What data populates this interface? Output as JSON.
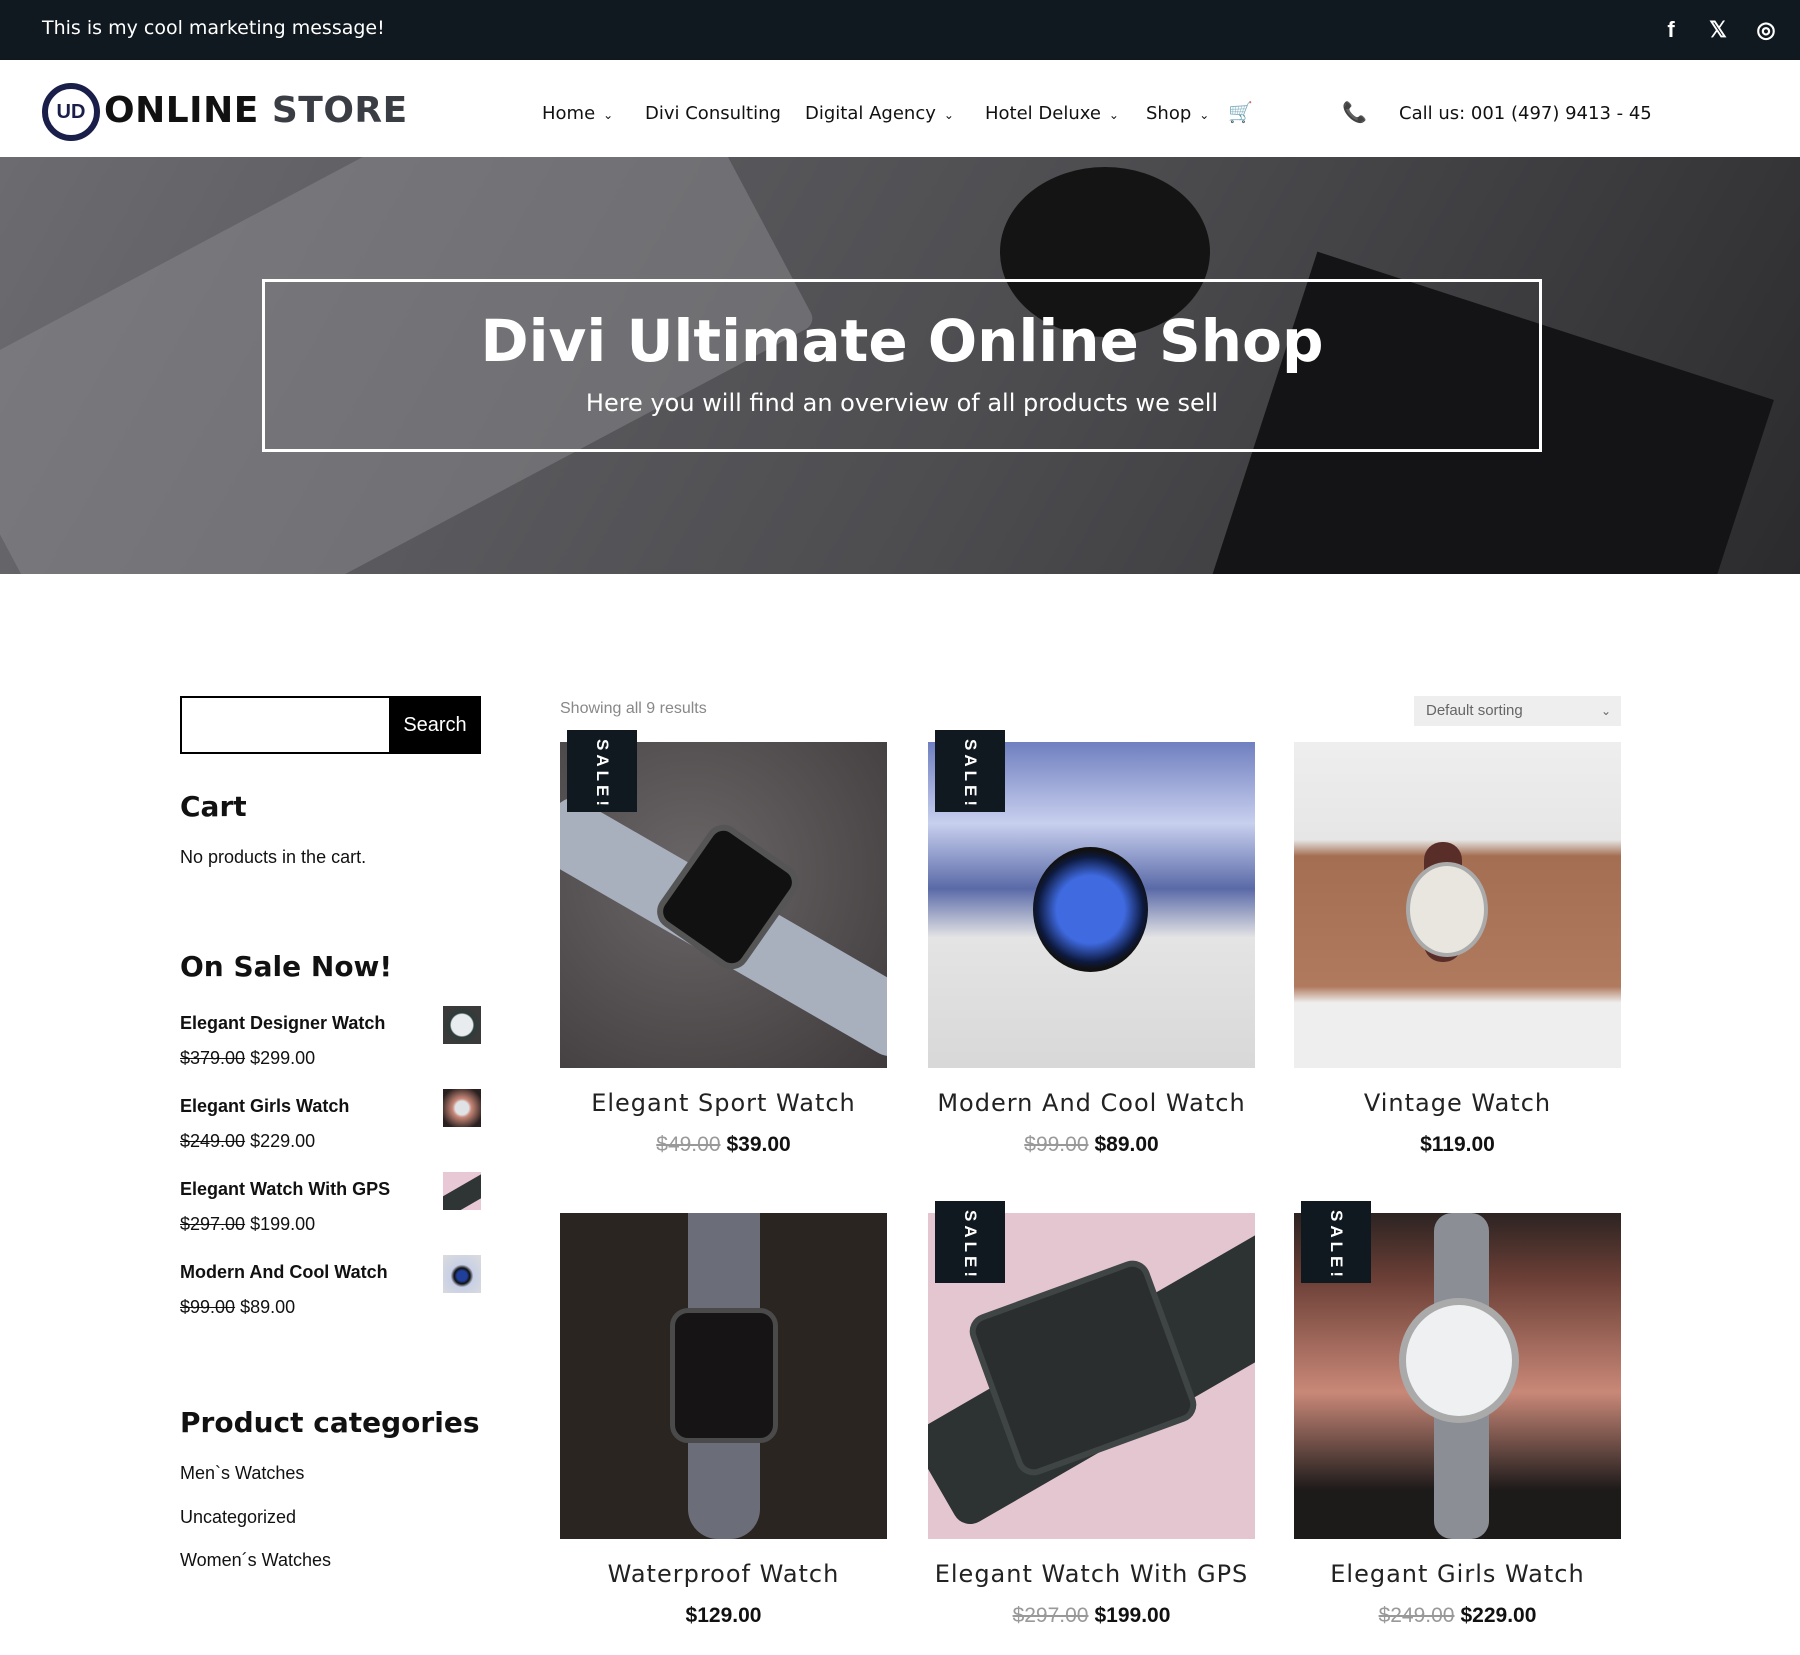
{
  "topbar": {
    "message": "This is my cool marketing message!",
    "social": [
      {
        "icon": "facebook-icon",
        "glyph": "f"
      },
      {
        "icon": "x-icon",
        "glyph": "𝕏"
      },
      {
        "icon": "instagram-icon",
        "glyph": "◎"
      }
    ]
  },
  "header": {
    "logo_mark": "UD",
    "logo_text_1": "ONLINE",
    "logo_text_2": "STORE",
    "nav": [
      {
        "label": "Home",
        "dropdown": true
      },
      {
        "label": "Divi Consulting",
        "dropdown": false
      },
      {
        "label": "Digital Agency",
        "dropdown": true
      },
      {
        "label": "Hotel Deluxe",
        "dropdown": true
      },
      {
        "label": "Shop",
        "dropdown": true
      }
    ],
    "cart_icon": "🛒",
    "phone_icon": "📞",
    "call_text": "Call us: 001 (497) 9413 - 45"
  },
  "hero": {
    "title": "Divi Ultimate Online Shop",
    "subtitle": "Here you will find an overview of all products we sell"
  },
  "sidebar": {
    "search_button": "Search",
    "search_value": "",
    "cart_title": "Cart",
    "cart_empty": "No products in the cart.",
    "sale_title": "On Sale Now!",
    "sale_items": [
      {
        "name": "Elegant Designer Watch",
        "old": "$379.00",
        "price": "$299.00"
      },
      {
        "name": "Elegant Girls Watch",
        "old": "$249.00",
        "price": "$229.00"
      },
      {
        "name": "Elegant Watch With GPS",
        "old": "$297.00",
        "price": "$199.00"
      },
      {
        "name": "Modern And Cool Watch",
        "old": "$99.00",
        "price": "$89.00"
      }
    ],
    "categories_title": "Product categories",
    "categories": [
      "Men`s Watches",
      "Uncategorized",
      "Women´s Watches"
    ]
  },
  "shop": {
    "result_count": "Showing all 9 results",
    "sorting": "Default sorting",
    "sale_badge": "SALE!",
    "products": [
      {
        "name": "Elegant Sport Watch",
        "old": "$49.00",
        "price": "$39.00",
        "sale": true
      },
      {
        "name": "Modern And Cool Watch",
        "old": "$99.00",
        "price": "$89.00",
        "sale": true
      },
      {
        "name": "Vintage Watch",
        "old": "",
        "price": "$119.00",
        "sale": false
      },
      {
        "name": "Waterproof Watch",
        "old": "",
        "price": "$129.00",
        "sale": false
      },
      {
        "name": "Elegant Watch With GPS",
        "old": "$297.00",
        "price": "$199.00",
        "sale": true
      },
      {
        "name": "Elegant Girls Watch",
        "old": "$249.00",
        "price": "$229.00",
        "sale": true
      }
    ]
  },
  "colors": {
    "topbar": "#101820",
    "badge": "#101820",
    "logo": "#1a1f4a"
  }
}
